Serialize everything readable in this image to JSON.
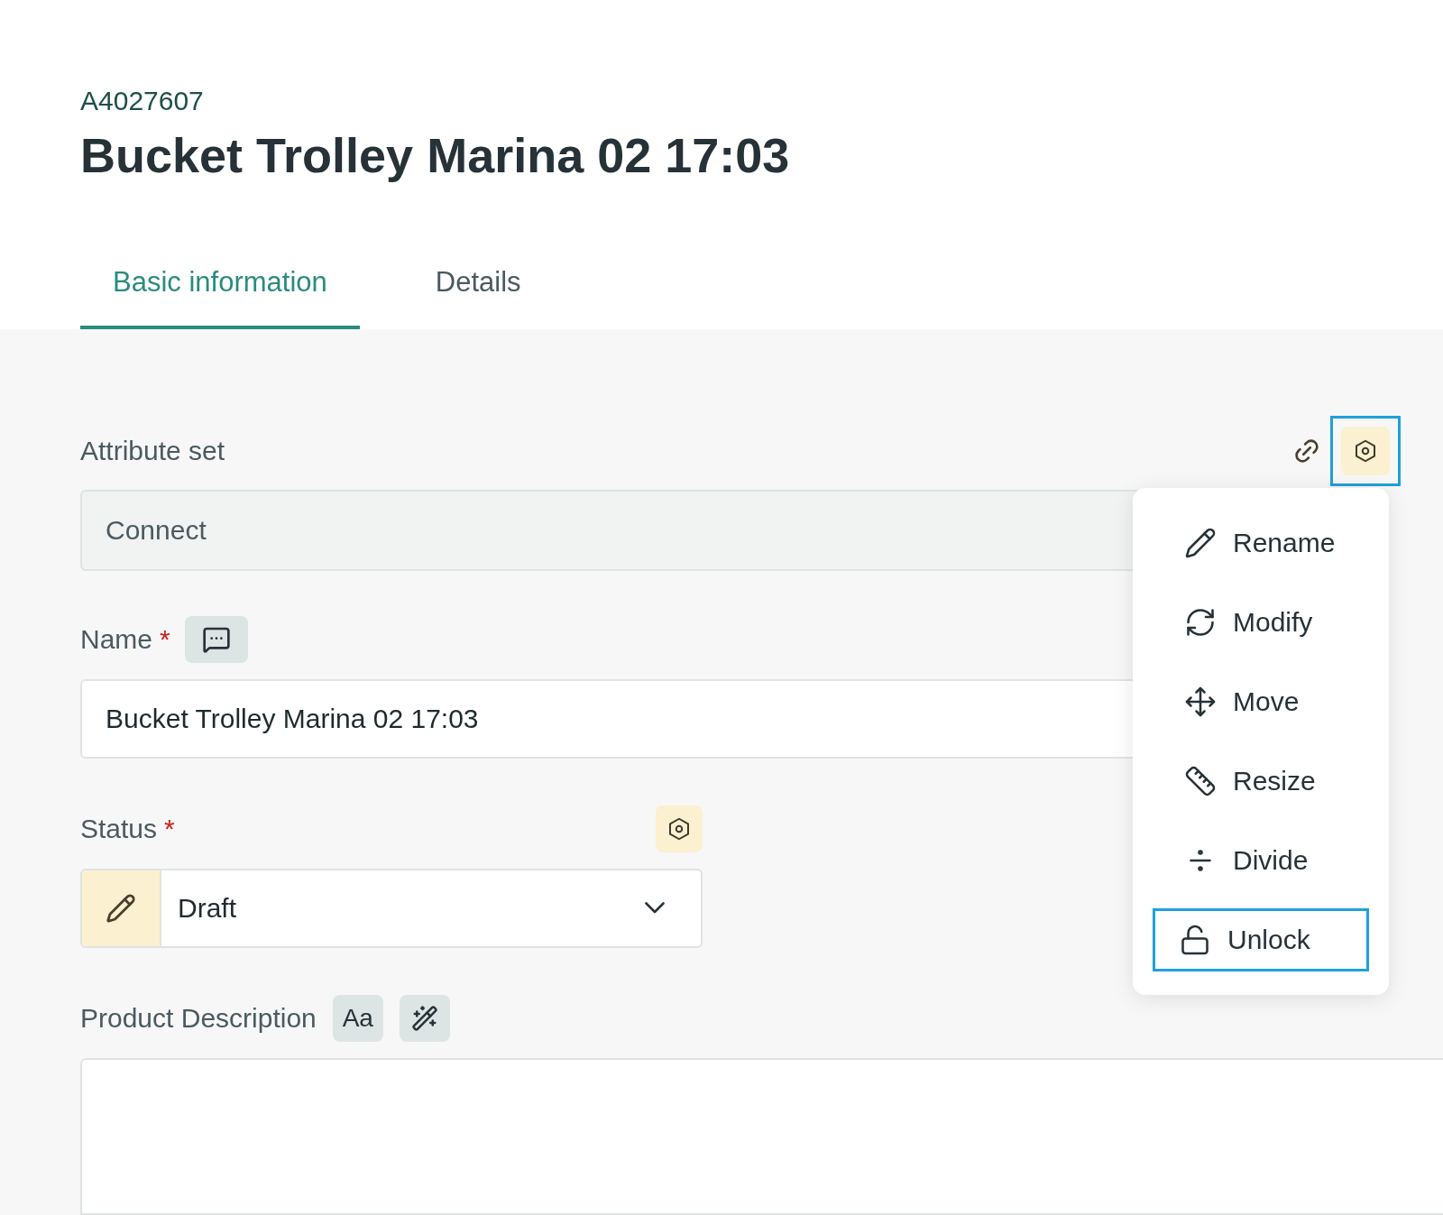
{
  "header": {
    "id": "A4027607",
    "title": "Bucket Trolley Marina 02 17:03"
  },
  "tabs": [
    {
      "label": "Basic information",
      "selected": true
    },
    {
      "label": "Details",
      "selected": false
    }
  ],
  "attribute_set": {
    "label": "Attribute set",
    "value": "Connect",
    "disabled": true,
    "settings_focused": true
  },
  "name_field": {
    "label": "Name",
    "required_mark": "*",
    "value": "Bucket Trolley Marina 02 17:03"
  },
  "status_field": {
    "label": "Status",
    "required_mark": "*",
    "value": "Draft"
  },
  "description": {
    "label": "Product Description",
    "format_button": "Aa"
  },
  "menu": {
    "items": [
      {
        "label": "Rename",
        "focused": false
      },
      {
        "label": "Modify",
        "focused": false
      },
      {
        "label": "Move",
        "focused": false
      },
      {
        "label": "Resize",
        "focused": false
      },
      {
        "label": "Divide",
        "focused": false
      },
      {
        "label": "Unlock",
        "focused": true
      }
    ]
  }
}
